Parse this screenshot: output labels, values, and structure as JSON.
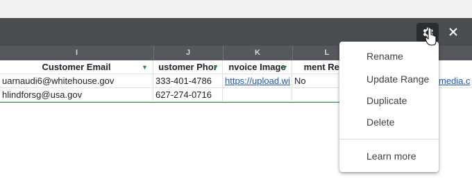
{
  "columns": [
    "I",
    "J",
    "K",
    "L"
  ],
  "headers": {
    "email": "Customer Email",
    "phone": "ustomer Phor",
    "invoice": "nvoice Image",
    "payment": "ment Rece"
  },
  "rows": [
    {
      "email": "uarnaudi6@whitehouse.gov",
      "phone": "333-401-4786",
      "invoice": "https://upload.wi",
      "payment": "No",
      "extra": "media.c"
    },
    {
      "email": "hlindforsg@usa.gov",
      "phone": "627-274-0716",
      "invoice": "",
      "payment": "",
      "extra": ""
    }
  ],
  "menu": {
    "rename": "Rename",
    "update_range": "Update Range",
    "duplicate": "Duplicate",
    "delete": "Delete",
    "learn_more": "Learn more"
  },
  "icons": {
    "settings": "gear-icon",
    "close": "close-icon",
    "filter": "filter-icon",
    "cursor": "hand-cursor-icon"
  },
  "colors": {
    "toolbar": "#4a4d50",
    "column_header": "#55585c",
    "link": "#1a55c9",
    "filter": "#1e8e3e"
  }
}
